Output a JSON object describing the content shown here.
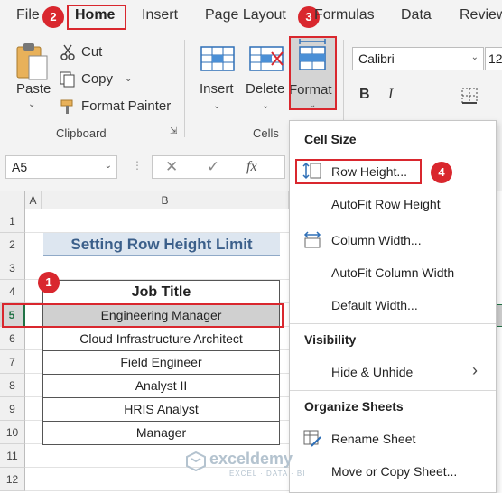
{
  "tabs": {
    "file": "File",
    "home": "Home",
    "insert": "Insert",
    "page_layout": "Page Layout",
    "formulas": "Formulas",
    "data": "Data",
    "review": "Review"
  },
  "badges": {
    "b1": "1",
    "b2": "2",
    "b3": "3",
    "b4": "4"
  },
  "ribbon": {
    "paste": "Paste",
    "cut": "Cut",
    "copy": "Copy",
    "format_painter": "Format Painter",
    "clipboard_label": "Clipboard",
    "insert": "Insert",
    "delete": "Delete",
    "format": "Format",
    "cells_label": "Cells",
    "font_name": "Calibri",
    "font_size": "12",
    "bold": "B",
    "italic": "I"
  },
  "formula_bar": {
    "name_box": "A5",
    "fx": "fx"
  },
  "columns": [
    "A",
    "B"
  ],
  "rows": [
    "1",
    "2",
    "3",
    "4",
    "5",
    "6",
    "7",
    "8",
    "9",
    "10",
    "11",
    "12"
  ],
  "sheet": {
    "title": "Setting Row Height Limit",
    "header": "Job Title",
    "jobs": [
      "Engineering Manager",
      "Cloud Infrastructure Architect",
      "Field Engineer",
      "Analyst II",
      "HRIS Analyst",
      "Manager"
    ]
  },
  "menu": {
    "cell_size": "Cell Size",
    "row_height": "Row Height...",
    "autofit_row": "AutoFit Row Height",
    "column_width": "Column Width...",
    "autofit_col": "AutoFit Column Width",
    "default_width": "Default Width...",
    "visibility": "Visibility",
    "hide_unhide": "Hide & Unhide",
    "organize": "Organize Sheets",
    "rename": "Rename Sheet",
    "move_copy": "Move or Copy Sheet..."
  },
  "watermark": {
    "brand": "exceldemy",
    "tagline": "EXCEL · DATA · BI"
  },
  "colors": {
    "accent_red": "#d9272e",
    "selected_row": "#d0d0d0",
    "title_blue": "#3b5f8a",
    "title_bg": "#dde6f0",
    "green": "#217346"
  }
}
